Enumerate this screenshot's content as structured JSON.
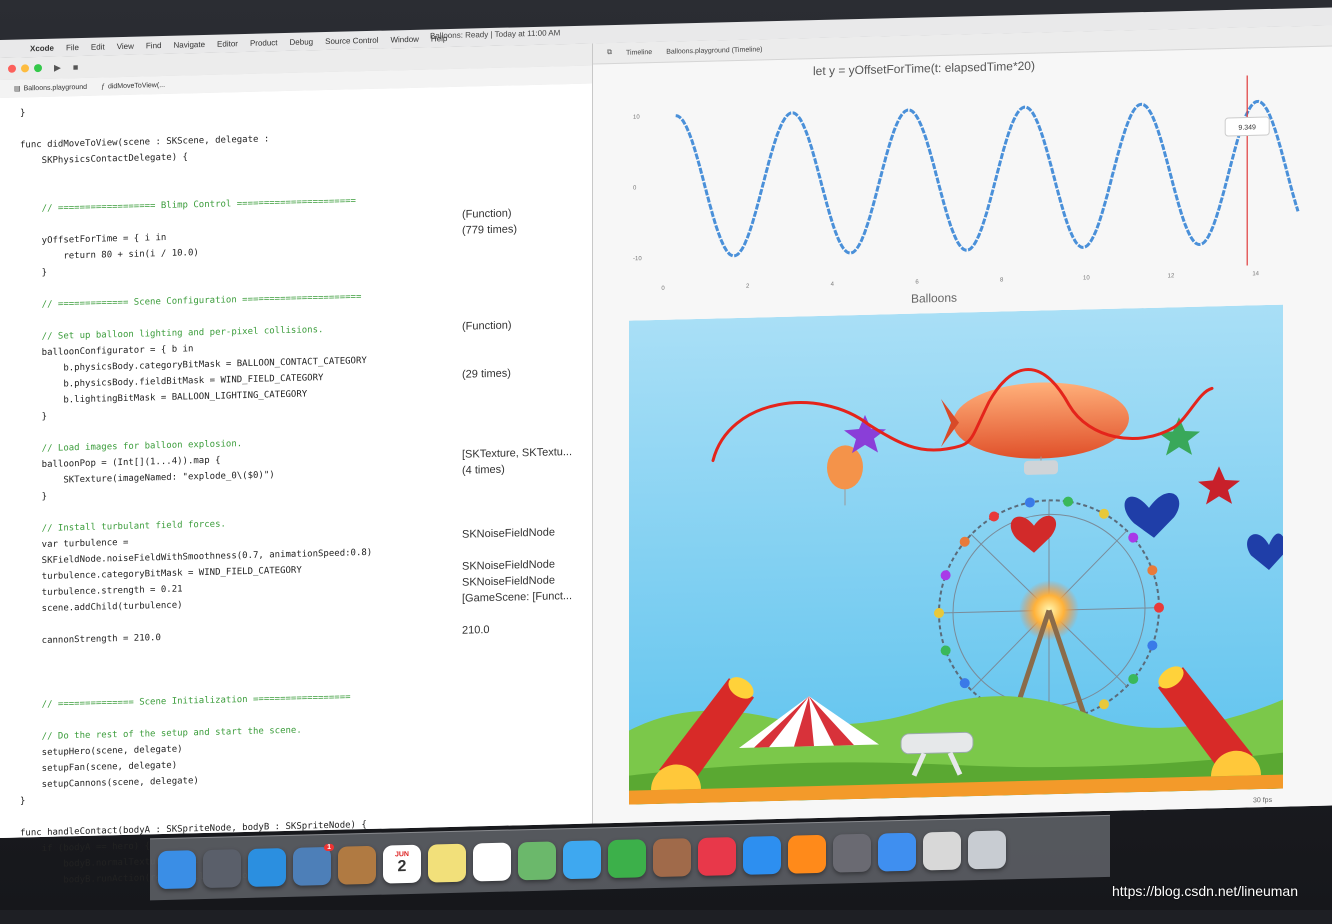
{
  "menubar": {
    "items": [
      "Xcode",
      "File",
      "Edit",
      "View",
      "Find",
      "Navigate",
      "Editor",
      "Product",
      "Debug",
      "Source Control",
      "Window",
      "Help"
    ],
    "status": "Balloons: Ready | Today at 11:00 AM"
  },
  "editor": {
    "tabs": [
      "Balloons.playground",
      "didMoveToView(..."
    ],
    "lines": [
      {
        "kind": "plain",
        "text": "}"
      },
      {
        "kind": "blank",
        "text": ""
      },
      {
        "kind": "plain",
        "text": "func didMoveToView(scene : SKScene, delegate :"
      },
      {
        "kind": "plain",
        "text": "    SKPhysicsContactDelegate) {"
      },
      {
        "kind": "blank",
        "text": ""
      },
      {
        "kind": "blank",
        "text": ""
      },
      {
        "kind": "comment",
        "text": "    // ================== Blimp Control ======================"
      },
      {
        "kind": "blank",
        "text": ""
      },
      {
        "kind": "plain",
        "text": "    yOffsetForTime = { i in"
      },
      {
        "kind": "plain",
        "text": "        return 80 + sin(i / 10.0)"
      },
      {
        "kind": "plain",
        "text": "    }"
      },
      {
        "kind": "blank",
        "text": ""
      },
      {
        "kind": "comment",
        "text": "    // ============= Scene Configuration ======================"
      },
      {
        "kind": "blank",
        "text": ""
      },
      {
        "kind": "comment",
        "text": "    // Set up balloon lighting and per-pixel collisions."
      },
      {
        "kind": "plain",
        "text": "    balloonConfigurator = { b in"
      },
      {
        "kind": "plain",
        "text": "        b.physicsBody.categoryBitMask = BALLOON_CONTACT_CATEGORY"
      },
      {
        "kind": "plain",
        "text": "        b.physicsBody.fieldBitMask = WIND_FIELD_CATEGORY"
      },
      {
        "kind": "plain",
        "text": "        b.lightingBitMask = BALLOON_LIGHTING_CATEGORY"
      },
      {
        "kind": "plain",
        "text": "    }"
      },
      {
        "kind": "blank",
        "text": ""
      },
      {
        "kind": "comment",
        "text": "    // Load images for balloon explosion."
      },
      {
        "kind": "plain",
        "text": "    balloonPop = (Int[](1...4)).map {"
      },
      {
        "kind": "plain",
        "text": "        SKTexture(imageNamed: \"explode_0\\($0)\")"
      },
      {
        "kind": "plain",
        "text": "    }"
      },
      {
        "kind": "blank",
        "text": ""
      },
      {
        "kind": "comment",
        "text": "    // Install turbulant field forces."
      },
      {
        "kind": "plain",
        "text": "    var turbulence ="
      },
      {
        "kind": "plain",
        "text": "    SKFieldNode.noiseFieldWithSmoothness(0.7, animationSpeed:0.8)"
      },
      {
        "kind": "plain",
        "text": "    turbulence.categoryBitMask = WIND_FIELD_CATEGORY"
      },
      {
        "kind": "plain",
        "text": "    turbulence.strength = 0.21"
      },
      {
        "kind": "plain",
        "text": "    scene.addChild(turbulence)"
      },
      {
        "kind": "blank",
        "text": ""
      },
      {
        "kind": "plain",
        "text": "    cannonStrength = 210.0"
      },
      {
        "kind": "blank",
        "text": ""
      },
      {
        "kind": "blank",
        "text": ""
      },
      {
        "kind": "blank",
        "text": ""
      },
      {
        "kind": "comment",
        "text": "    // ============== Scene Initialization =================="
      },
      {
        "kind": "blank",
        "text": ""
      },
      {
        "kind": "comment",
        "text": "    // Do the rest of the setup and start the scene."
      },
      {
        "kind": "plain",
        "text": "    setupHero(scene, delegate)"
      },
      {
        "kind": "plain",
        "text": "    setupFan(scene, delegate)"
      },
      {
        "kind": "plain",
        "text": "    setupCannons(scene, delegate)"
      },
      {
        "kind": "plain",
        "text": "}"
      },
      {
        "kind": "blank",
        "text": ""
      },
      {
        "kind": "plain",
        "text": "func handleContact(bodyA : SKSpriteNode, bodyB : SKSpriteNode) {"
      },
      {
        "kind": "plain",
        "text": "    if (bodyA == hero) {"
      },
      {
        "kind": "plain",
        "text": "        bodyB.normalTexture = nil"
      },
      {
        "kind": "plain",
        "text": "        bodyB.runAction(removeBalloonAction)"
      }
    ],
    "results": [
      {
        "line": 7,
        "text": "(Function)"
      },
      {
        "line": 8,
        "text": "(779 times)"
      },
      {
        "line": 14,
        "text": "(Function)"
      },
      {
        "line": 17,
        "text": "(29 times)"
      },
      {
        "line": 22,
        "text": "[SKTexture, SKTextu..."
      },
      {
        "line": 23,
        "text": "(4 times)"
      },
      {
        "line": 27,
        "text": "SKNoiseFieldNode"
      },
      {
        "line": 29,
        "text": "SKNoiseFieldNode"
      },
      {
        "line": 30,
        "text": "SKNoiseFieldNode"
      },
      {
        "line": 31,
        "text": "[GameScene: [Funct..."
      },
      {
        "line": 33,
        "text": "210.0"
      }
    ]
  },
  "assistant": {
    "tabs": [
      "Timeline",
      "Balloons.playground (Timeline)"
    ],
    "graph_title": "let y = yOffsetForTime(t: elapsedTime*20)",
    "scene_title": "Balloons",
    "zoom": "30 fps"
  },
  "chart_data": {
    "type": "line",
    "title": "let y = yOffsetForTime(t: elapsedTime*20)",
    "xlabel": "",
    "ylabel": "",
    "xlim": [
      0,
      15
    ],
    "ylim": [
      -12,
      12
    ],
    "x_ticks": [
      0,
      2,
      4,
      6,
      8,
      10,
      12,
      14
    ],
    "y_ticks": [
      10,
      0,
      -10
    ],
    "series": [
      {
        "color": "#4a90d9",
        "amplitude": 10,
        "period": 2.75
      }
    ],
    "marker": {
      "x": 13.8,
      "label": "9.349"
    },
    "grid": false
  },
  "dock": {
    "icons": [
      "finder-icon",
      "launchpad-icon",
      "safari-icon",
      "mail-icon",
      "contacts-icon",
      "calendar-icon",
      "notes-icon",
      "reminders-icon",
      "maps-icon",
      "messages-icon",
      "facetime-icon",
      "photo-booth-icon",
      "itunes-icon",
      "app-store-icon",
      "ibooks-icon",
      "system-preferences-icon",
      "xcode-icon",
      "photos-icon",
      "trash-icon"
    ],
    "calendar_day": "2",
    "calendar_month": "JUN",
    "mail_badge": "1"
  },
  "watermark": "https://blog.csdn.net/lineuman",
  "colors": {
    "keyword": "#b0216a",
    "type": "#4b21b0",
    "comment": "#3c9d3c",
    "graph": "#4a90d9",
    "marker": "#e03a3a",
    "annotation": "#e4241b"
  }
}
